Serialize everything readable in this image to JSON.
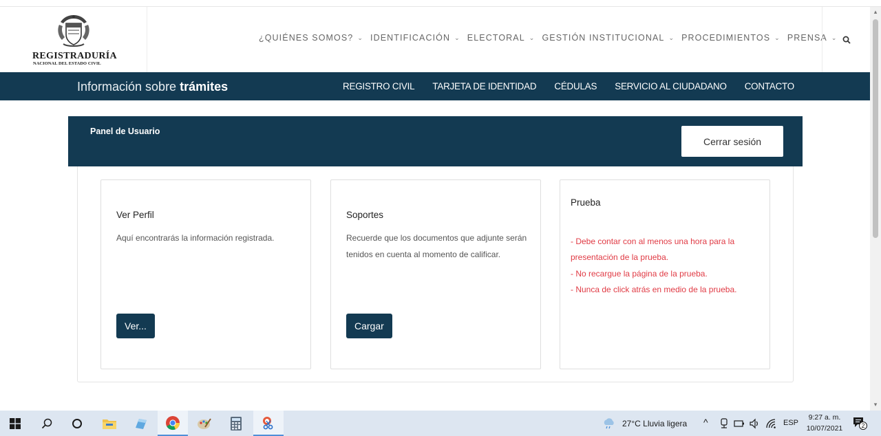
{
  "logo": {
    "title": "REGISTRADURÍA",
    "subtitle": "NACIONAL DEL ESTADO CIVIL"
  },
  "nav": {
    "items": [
      {
        "label": "¿QUIÉNES SOMOS?"
      },
      {
        "label": "IDENTIFICACIÓN"
      },
      {
        "label": "ELECTORAL"
      },
      {
        "label": "GESTIÓN INSTITUCIONAL"
      },
      {
        "label": "PROCEDIMIENTOS"
      },
      {
        "label": "PRENSA"
      }
    ]
  },
  "subnav": {
    "title_prefix": "Información sobre ",
    "title_bold": "trámites",
    "links": [
      {
        "label": "REGISTRO CIVIL"
      },
      {
        "label": "TARJETA DE IDENTIDAD"
      },
      {
        "label": "CÉDULAS"
      },
      {
        "label": "SERVICIO AL CIUDADANO"
      },
      {
        "label": "CONTACTO"
      }
    ]
  },
  "panel": {
    "title": "Panel de Usuario",
    "logout_label": "Cerrar sesión"
  },
  "cards": [
    {
      "title": "Ver Perfil",
      "text": "Aquí encontrarás la información registrada.",
      "button": "Ver..."
    },
    {
      "title": "Soportes",
      "text": "Recuerde que los documentos que adjunte serán tenidos en cuenta al momento de calificar.",
      "button": "Cargar"
    },
    {
      "title": "Prueba",
      "notes": [
        "- Debe contar con al menos una hora para la presentación de la prueba.",
        "- No recargue la página de la prueba.",
        "- Nunca de click atrás en medio de la prueba."
      ]
    }
  ],
  "taskbar": {
    "weather": "27°C  Lluvia ligera",
    "language": "ESP",
    "time": "9:27 a. m.",
    "date": "10/07/2021",
    "notification_count": "2"
  },
  "colors": {
    "brand_navy": "#133a52",
    "warning_red": "#e03a44"
  }
}
